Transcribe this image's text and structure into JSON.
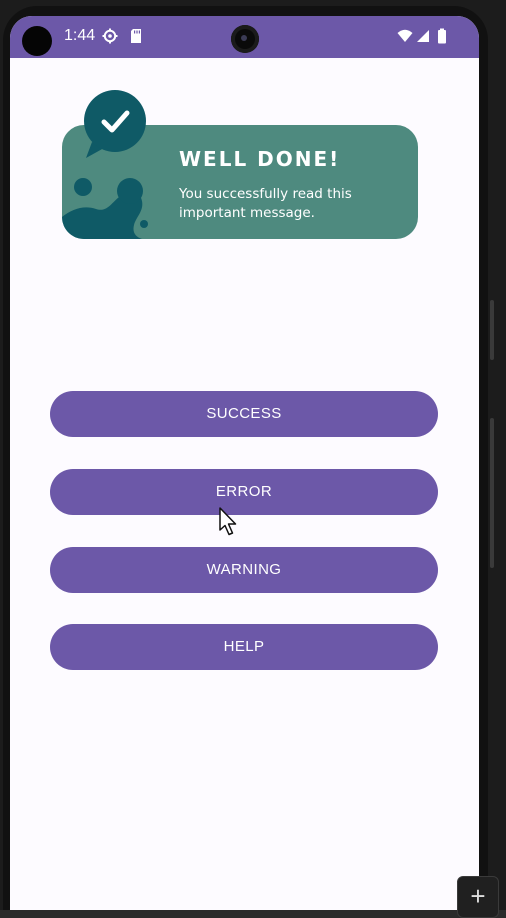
{
  "status_bar": {
    "time": "1:44",
    "color": "#6c58a8"
  },
  "toast": {
    "title": "WELL DONE!",
    "message": "You successfully read this important message.",
    "background": "#4e8a7f",
    "accent": "#0f5a66",
    "icon": "checkmark-icon"
  },
  "buttons": {
    "success": "SUCCESS",
    "error": "ERROR",
    "warning": "WARNING",
    "help": "HELP",
    "color": "#6c58a8"
  },
  "emulator": {
    "plus_label": "+"
  }
}
